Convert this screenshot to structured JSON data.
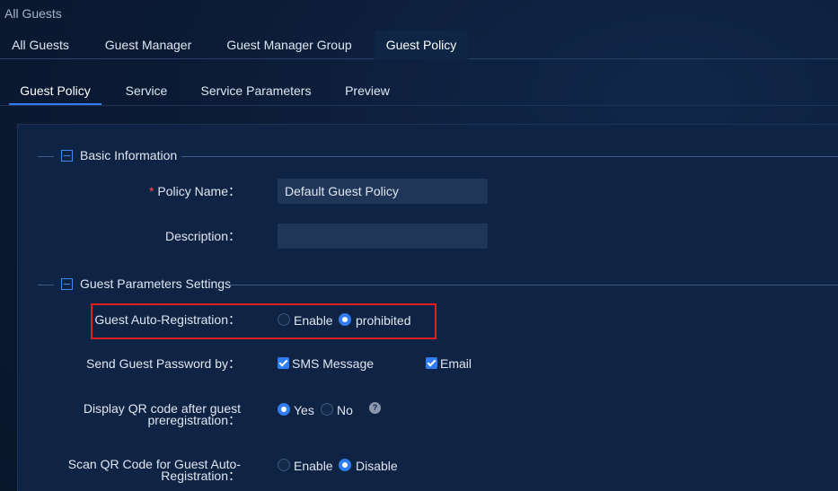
{
  "breadcrumb": "All Guests",
  "top_tabs": [
    "All Guests",
    "Guest Manager",
    "Guest Manager Group",
    "Guest Policy"
  ],
  "sub_tabs": [
    "Guest Policy",
    "Service",
    "Service Parameters",
    "Preview"
  ],
  "sections": {
    "basic": "Basic Information",
    "guest_params": "Guest Parameters Settings"
  },
  "fields": {
    "policy_name": {
      "required_mark": "*",
      "label": "Policy Name：",
      "value": "Default Guest Policy"
    },
    "description": {
      "label": "Description：",
      "value": ""
    },
    "auto_registration": {
      "label": "Guest Auto-Registration：",
      "options": [
        "Enable",
        "prohibited"
      ],
      "selected": "prohibited"
    },
    "send_password": {
      "label": "Send Guest Password by：",
      "options": [
        "SMS Message",
        "Email"
      ],
      "checked": [
        "SMS Message",
        "Email"
      ]
    },
    "display_qr": {
      "label_line1": "Display QR code after guest",
      "label_line2": "preregistration：",
      "options": [
        "Yes",
        "No"
      ],
      "selected": "Yes",
      "help": "?"
    },
    "scan_qr": {
      "label_line1": "Scan QR Code for Guest Auto-",
      "label_line2": "Registration：",
      "options": [
        "Enable",
        "Disable"
      ],
      "selected": "Disable"
    }
  },
  "colors": {
    "accent": "#2f7df0",
    "highlight": "#e02020",
    "background": "#0b1a33"
  }
}
